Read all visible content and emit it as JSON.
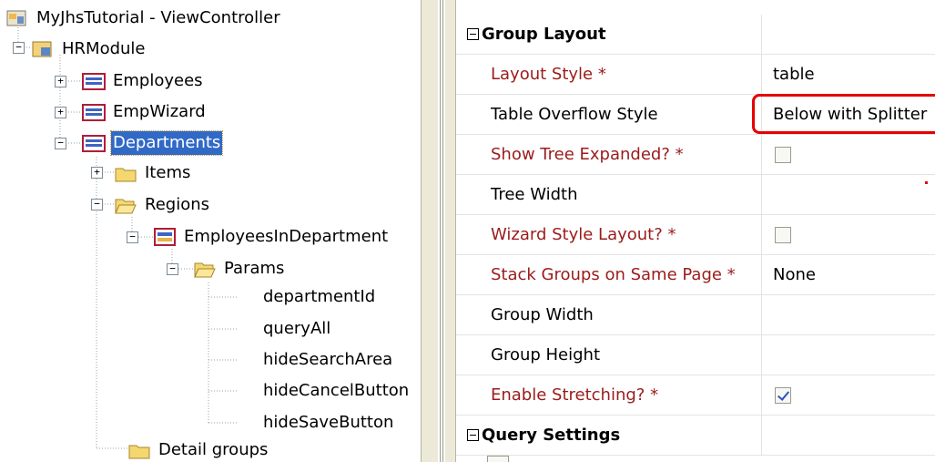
{
  "tree": {
    "root": "MyJhsTutorial - ViewController",
    "module": "HRModule",
    "employees": "Employees",
    "empwizard": "EmpWizard",
    "departments": "Departments",
    "items": "Items",
    "regions": "Regions",
    "employees_in_department": "EmployeesInDepartment",
    "params": "Params",
    "param_items": [
      "departmentId",
      "queryAll",
      "hideSearchArea",
      "hideCancelButton",
      "hideSaveButton"
    ],
    "detail_groups": "Detail groups"
  },
  "properties": {
    "group_layout": {
      "title": "Group Layout"
    },
    "rows": [
      {
        "name": "Layout Style *",
        "value": "table"
      },
      {
        "name": "Table Overflow Style",
        "value": "Below with Splitter"
      },
      {
        "name": "Show Tree Expanded? *",
        "checked": false
      },
      {
        "name": "Tree Width",
        "value": ""
      },
      {
        "name": "Wizard Style Layout? *",
        "checked": false
      },
      {
        "name": "Stack Groups on Same Page *",
        "value": "None"
      },
      {
        "name": "Group Width",
        "value": ""
      },
      {
        "name": "Group Height",
        "value": ""
      },
      {
        "name": "Enable Stretching? *",
        "checked": true
      }
    ],
    "query_settings": {
      "title": "Query Settings"
    }
  },
  "colors": {
    "required_label": "#9b1b1b",
    "selection": "#3169c6",
    "highlight": "#e60000"
  }
}
